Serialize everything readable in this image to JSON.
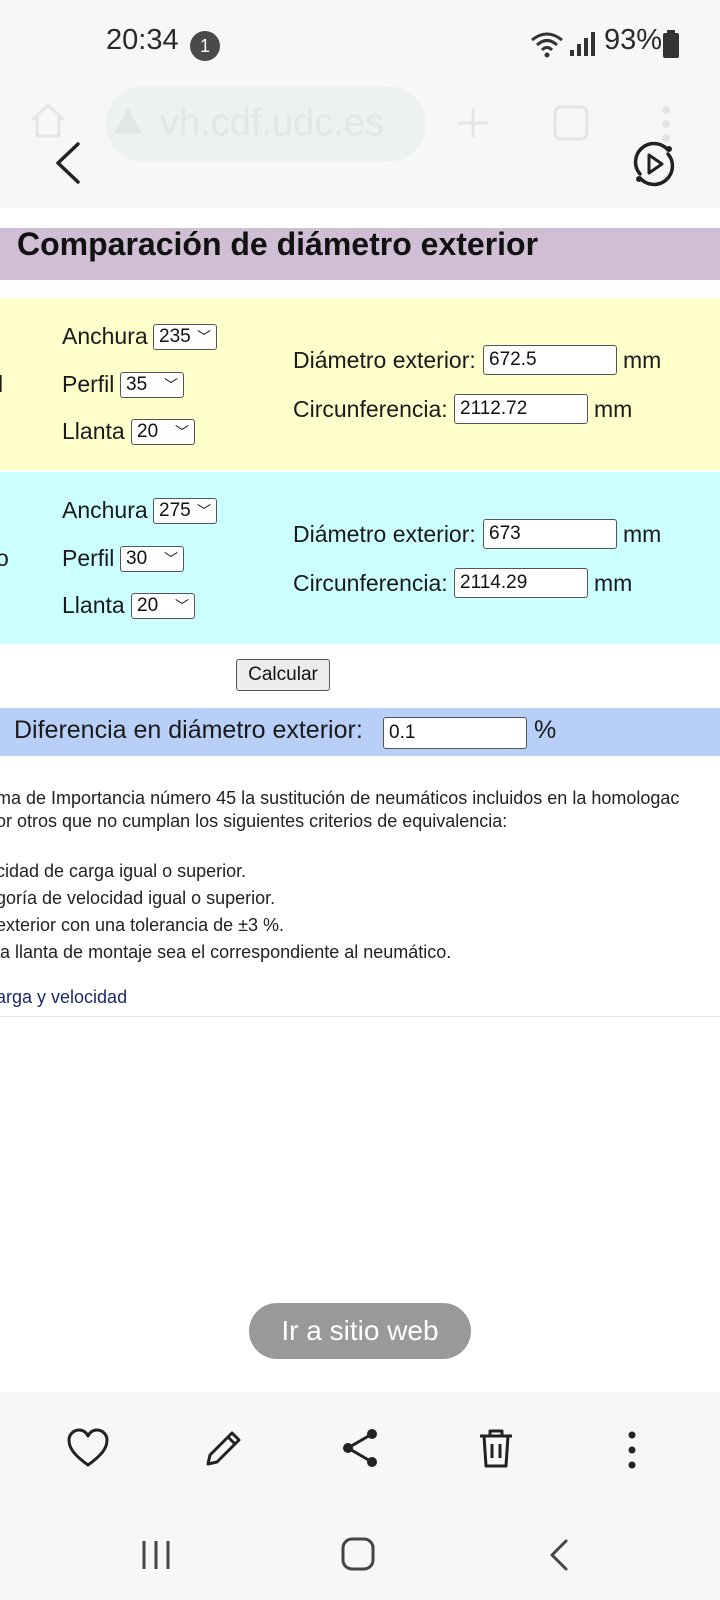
{
  "status_bar": {
    "time": "20:34",
    "notification_count": "1",
    "battery": "93%"
  },
  "browser": {
    "url": "vh.cdf.udc.es"
  },
  "page": {
    "title": "Comparación de diámetro exterior",
    "tyre1": {
      "left_fragment": "l",
      "anchura_label": "Anchura",
      "anchura_value": "235",
      "perfil_label": "Perfil",
      "perfil_value": "35",
      "llanta_label": "Llanta",
      "llanta_value": "20",
      "diametro_label": "Diámetro exterior:",
      "diametro_value": "672.5",
      "diametro_unit": "mm",
      "circ_label": "Circunferencia:",
      "circ_value": "2112.72",
      "circ_unit": "mm"
    },
    "tyre2": {
      "left_fragment": "o",
      "anchura_label": "Anchura",
      "anchura_value": "275",
      "perfil_label": "Perfil",
      "perfil_value": "30",
      "llanta_label": "Llanta",
      "llanta_value": "20",
      "diametro_label": "Diámetro exterior:",
      "diametro_value": "673",
      "diametro_unit": "mm",
      "circ_label": "Circunferencia:",
      "circ_value": "2114.29",
      "circ_unit": "mm"
    },
    "calc_button": "Calcular",
    "diff_label": "Diferencia en diámetro exterior:",
    "diff_value": "0.1",
    "diff_unit": "%",
    "text_lines": [
      "ma de Importancia número 45 la sustitución de neumáticos incluidos en la homologac",
      "or otros que no cumplan los siguientes criterios de equivalencia:",
      "cidad de carga igual o superior.",
      "goría de velocidad igual o superior.",
      "exterior con una tolerancia de ±3 %.",
      " la llanta de montaje sea el correspondiente al neumático."
    ],
    "link_text": "arga y velocidad"
  },
  "goto_button": "Ir a sitio web",
  "icons": {
    "heart": "heart-icon",
    "edit": "pencil-icon",
    "share": "share-icon",
    "delete": "trash-icon",
    "more": "more-vertical-icon"
  }
}
